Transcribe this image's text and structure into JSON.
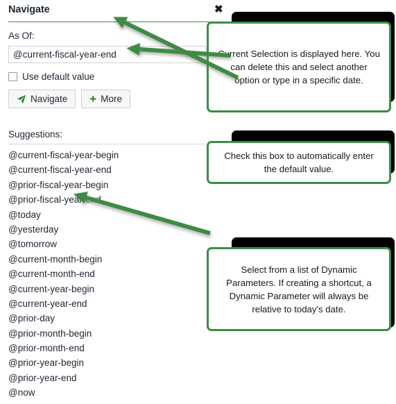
{
  "dialog": {
    "title": "Navigate",
    "close_icon": "close-x-icon",
    "asof_label": "As Of:",
    "asof_value": "@current-fiscal-year-end",
    "asof_placeholder": "",
    "use_default_label": "Use default value",
    "use_default_checked": false,
    "buttons": [
      {
        "label": "Navigate",
        "icon": "paper-plane-icon"
      },
      {
        "label": "More",
        "icon": "plus-icon"
      }
    ],
    "suggestions_label": "Suggestions:",
    "suggestions": [
      "@current-fiscal-year-begin",
      "@current-fiscal-year-end",
      "@prior-fiscal-year-begin",
      "@prior-fiscal-year-end",
      "@today",
      "@yesterday",
      "@tomorrow",
      "@current-month-begin",
      "@current-month-end",
      "@current-year-begin",
      "@current-year-end",
      "@prior-day",
      "@prior-month-begin",
      "@prior-month-end",
      "@prior-year-begin",
      "@prior-year-end",
      "@now"
    ]
  },
  "annotations": [
    {
      "id": "callout-current-selection",
      "text": "Current Selection is displayed here. You can delete this and select another option or type in a specific date."
    },
    {
      "id": "callout-default-value",
      "text": "Check this box to automatically enter the default value."
    },
    {
      "id": "callout-dynamic-parameters",
      "text": "Select from a list of Dynamic Parameters. If creating a shortcut, a Dynamic Parameter will always be relative to today's date."
    }
  ],
  "colors": {
    "accent_green": "#3e8b44",
    "icon_green": "#1e7a32",
    "text_dark": "#1d2733",
    "shadow_black": "#000000"
  }
}
